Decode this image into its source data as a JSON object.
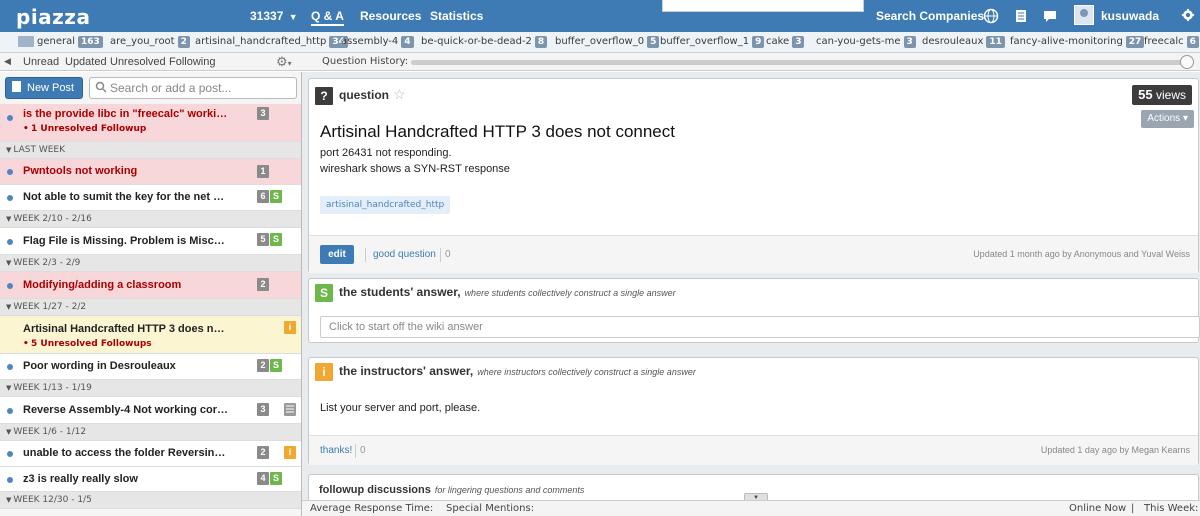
{
  "topbar": {
    "logo": "piazza",
    "course": "31337",
    "course_caret": "▼",
    "nav": [
      "Q & A",
      "Resources",
      "Statistics"
    ],
    "search_companies": "Search Companies",
    "username": "kusuwada",
    "icons": [
      "globe-icon",
      "notebook-icon",
      "chat-icon",
      "gear-icon"
    ]
  },
  "folders": [
    {
      "name": "general",
      "count": "163"
    },
    {
      "name": "are_you_root",
      "count": "2"
    },
    {
      "name": "artisinal_handcrafted_http",
      "count": "34"
    },
    {
      "name": "assembly-4",
      "count": "4"
    },
    {
      "name": "be-quick-or-be-dead-2",
      "count": "8"
    },
    {
      "name": "buffer_overflow_0",
      "count": "5"
    },
    {
      "name": "buffer_overflow_1",
      "count": "9"
    },
    {
      "name": "cake",
      "count": "3"
    },
    {
      "name": "can-you-gets-me",
      "count": "3"
    },
    {
      "name": "desrouleaux",
      "count": "11"
    },
    {
      "name": "fancy-alive-monitoring",
      "count": "27"
    },
    {
      "name": "freecalc",
      "count": "6"
    }
  ],
  "filters": [
    "Unread",
    "Updated",
    "Unresolved",
    "Following"
  ],
  "question_history_label": "Question History:",
  "left": {
    "new_post": "New Post",
    "search_placeholder": "Search or add a post...",
    "feed": [
      {
        "type": "item",
        "title": "is the provide libc in \"freecalc\" working?",
        "sub": "1 Unresolved Followup",
        "badges": [
          "3"
        ],
        "state": "unread"
      },
      {
        "type": "week",
        "label": "LAST WEEK"
      },
      {
        "type": "item",
        "title": "Pwntools not working",
        "badges": [
          "1"
        ],
        "state": "unread"
      },
      {
        "type": "item",
        "title": "Not able to sumit the key for the net ca...",
        "badges": [
          "6",
          "S"
        ],
        "state": "read"
      },
      {
        "type": "week",
        "label": "WEEK 2/10 - 2/16"
      },
      {
        "type": "item",
        "title": "Flag File is Missing. Problem is Miscon...",
        "badges": [
          "5",
          "S"
        ],
        "state": "read"
      },
      {
        "type": "week",
        "label": "WEEK 2/3 - 2/9"
      },
      {
        "type": "item",
        "title": "Modifying/adding a classroom",
        "badges": [
          "2"
        ],
        "state": "unread"
      },
      {
        "type": "week",
        "label": "WEEK 1/27 - 2/2"
      },
      {
        "type": "item",
        "title": "Artisinal Handcrafted HTTP 3 does not ...",
        "sub": "5 Unresolved Followups",
        "badges": [
          "i"
        ],
        "state": "selected"
      },
      {
        "type": "item",
        "title": "Poor wording in Desrouleaux",
        "badges": [
          "2",
          "S"
        ],
        "state": "read"
      },
      {
        "type": "week",
        "label": "WEEK 1/13 - 1/19"
      },
      {
        "type": "item",
        "title": "Reverse Assembly-4 Not working corr...",
        "badges": [
          "3",
          "note"
        ],
        "state": "read"
      },
      {
        "type": "week",
        "label": "WEEK 1/6 - 1/12"
      },
      {
        "type": "item",
        "title": "unable to access the folder Reversing ...",
        "badges": [
          "2",
          "i"
        ],
        "state": "read"
      },
      {
        "type": "item",
        "title": "z3 is really really slow",
        "badges": [
          "4",
          "S"
        ],
        "state": "read"
      },
      {
        "type": "week",
        "label": "WEEK 12/30 - 1/5"
      }
    ]
  },
  "question": {
    "label": "question",
    "views_count": "55",
    "views_label": "views",
    "actions": "Actions",
    "title": "Artisinal Handcrafted HTTP 3 does not connect",
    "body": [
      "port 26431 not responding.",
      "wireshark shows a SYN-RST response"
    ],
    "tag": "artisinal_handcrafted_http",
    "edit": "edit",
    "good_question": "good question",
    "good_count": "0",
    "updated": "Updated 1 month ago by Anonymous and Yuval Weiss"
  },
  "students_answer": {
    "icon": "S",
    "title": "the students' answer,",
    "subtitle": "where students collectively construct a single answer",
    "placeholder": "Click to start off the wiki answer"
  },
  "instructors_answer": {
    "icon": "i",
    "title": "the instructors' answer,",
    "subtitle": "where instructors collectively construct a single answer",
    "body": "List your server and port, please.",
    "thanks": "thanks!",
    "thanks_count": "0",
    "updated": "Updated 1 day ago by Megan Kearns"
  },
  "followup": {
    "title": "followup discussions",
    "subtitle": "for lingering questions and comments"
  },
  "bottombar": {
    "avg_response": "Average Response Time:",
    "special_mentions": "Special Mentions:",
    "online_now": "Online Now",
    "separator": "|",
    "this_week": "This Week:"
  }
}
